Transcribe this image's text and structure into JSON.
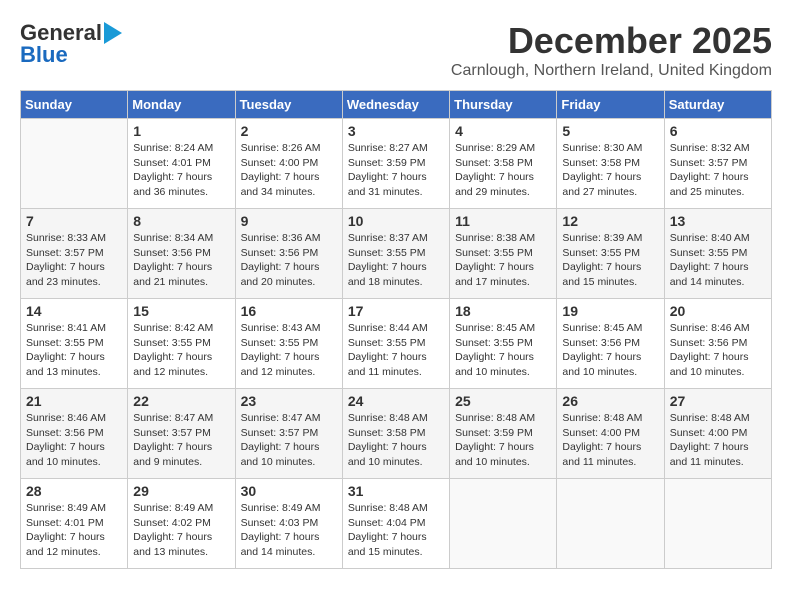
{
  "logo": {
    "line1": "General",
    "line2": "Blue"
  },
  "header": {
    "month": "December 2025",
    "location": "Carnlough, Northern Ireland, United Kingdom"
  },
  "weekdays": [
    "Sunday",
    "Monday",
    "Tuesday",
    "Wednesday",
    "Thursday",
    "Friday",
    "Saturday"
  ],
  "weeks": [
    [
      {
        "day": "",
        "sunrise": "",
        "sunset": "",
        "daylight": ""
      },
      {
        "day": "1",
        "sunrise": "Sunrise: 8:24 AM",
        "sunset": "Sunset: 4:01 PM",
        "daylight": "Daylight: 7 hours and 36 minutes."
      },
      {
        "day": "2",
        "sunrise": "Sunrise: 8:26 AM",
        "sunset": "Sunset: 4:00 PM",
        "daylight": "Daylight: 7 hours and 34 minutes."
      },
      {
        "day": "3",
        "sunrise": "Sunrise: 8:27 AM",
        "sunset": "Sunset: 3:59 PM",
        "daylight": "Daylight: 7 hours and 31 minutes."
      },
      {
        "day": "4",
        "sunrise": "Sunrise: 8:29 AM",
        "sunset": "Sunset: 3:58 PM",
        "daylight": "Daylight: 7 hours and 29 minutes."
      },
      {
        "day": "5",
        "sunrise": "Sunrise: 8:30 AM",
        "sunset": "Sunset: 3:58 PM",
        "daylight": "Daylight: 7 hours and 27 minutes."
      },
      {
        "day": "6",
        "sunrise": "Sunrise: 8:32 AM",
        "sunset": "Sunset: 3:57 PM",
        "daylight": "Daylight: 7 hours and 25 minutes."
      }
    ],
    [
      {
        "day": "7",
        "sunrise": "Sunrise: 8:33 AM",
        "sunset": "Sunset: 3:57 PM",
        "daylight": "Daylight: 7 hours and 23 minutes."
      },
      {
        "day": "8",
        "sunrise": "Sunrise: 8:34 AM",
        "sunset": "Sunset: 3:56 PM",
        "daylight": "Daylight: 7 hours and 21 minutes."
      },
      {
        "day": "9",
        "sunrise": "Sunrise: 8:36 AM",
        "sunset": "Sunset: 3:56 PM",
        "daylight": "Daylight: 7 hours and 20 minutes."
      },
      {
        "day": "10",
        "sunrise": "Sunrise: 8:37 AM",
        "sunset": "Sunset: 3:55 PM",
        "daylight": "Daylight: 7 hours and 18 minutes."
      },
      {
        "day": "11",
        "sunrise": "Sunrise: 8:38 AM",
        "sunset": "Sunset: 3:55 PM",
        "daylight": "Daylight: 7 hours and 17 minutes."
      },
      {
        "day": "12",
        "sunrise": "Sunrise: 8:39 AM",
        "sunset": "Sunset: 3:55 PM",
        "daylight": "Daylight: 7 hours and 15 minutes."
      },
      {
        "day": "13",
        "sunrise": "Sunrise: 8:40 AM",
        "sunset": "Sunset: 3:55 PM",
        "daylight": "Daylight: 7 hours and 14 minutes."
      }
    ],
    [
      {
        "day": "14",
        "sunrise": "Sunrise: 8:41 AM",
        "sunset": "Sunset: 3:55 PM",
        "daylight": "Daylight: 7 hours and 13 minutes."
      },
      {
        "day": "15",
        "sunrise": "Sunrise: 8:42 AM",
        "sunset": "Sunset: 3:55 PM",
        "daylight": "Daylight: 7 hours and 12 minutes."
      },
      {
        "day": "16",
        "sunrise": "Sunrise: 8:43 AM",
        "sunset": "Sunset: 3:55 PM",
        "daylight": "Daylight: 7 hours and 12 minutes."
      },
      {
        "day": "17",
        "sunrise": "Sunrise: 8:44 AM",
        "sunset": "Sunset: 3:55 PM",
        "daylight": "Daylight: 7 hours and 11 minutes."
      },
      {
        "day": "18",
        "sunrise": "Sunrise: 8:45 AM",
        "sunset": "Sunset: 3:55 PM",
        "daylight": "Daylight: 7 hours and 10 minutes."
      },
      {
        "day": "19",
        "sunrise": "Sunrise: 8:45 AM",
        "sunset": "Sunset: 3:56 PM",
        "daylight": "Daylight: 7 hours and 10 minutes."
      },
      {
        "day": "20",
        "sunrise": "Sunrise: 8:46 AM",
        "sunset": "Sunset: 3:56 PM",
        "daylight": "Daylight: 7 hours and 10 minutes."
      }
    ],
    [
      {
        "day": "21",
        "sunrise": "Sunrise: 8:46 AM",
        "sunset": "Sunset: 3:56 PM",
        "daylight": "Daylight: 7 hours and 10 minutes."
      },
      {
        "day": "22",
        "sunrise": "Sunrise: 8:47 AM",
        "sunset": "Sunset: 3:57 PM",
        "daylight": "Daylight: 7 hours and 9 minutes."
      },
      {
        "day": "23",
        "sunrise": "Sunrise: 8:47 AM",
        "sunset": "Sunset: 3:57 PM",
        "daylight": "Daylight: 7 hours and 10 minutes."
      },
      {
        "day": "24",
        "sunrise": "Sunrise: 8:48 AM",
        "sunset": "Sunset: 3:58 PM",
        "daylight": "Daylight: 7 hours and 10 minutes."
      },
      {
        "day": "25",
        "sunrise": "Sunrise: 8:48 AM",
        "sunset": "Sunset: 3:59 PM",
        "daylight": "Daylight: 7 hours and 10 minutes."
      },
      {
        "day": "26",
        "sunrise": "Sunrise: 8:48 AM",
        "sunset": "Sunset: 4:00 PM",
        "daylight": "Daylight: 7 hours and 11 minutes."
      },
      {
        "day": "27",
        "sunrise": "Sunrise: 8:48 AM",
        "sunset": "Sunset: 4:00 PM",
        "daylight": "Daylight: 7 hours and 11 minutes."
      }
    ],
    [
      {
        "day": "28",
        "sunrise": "Sunrise: 8:49 AM",
        "sunset": "Sunset: 4:01 PM",
        "daylight": "Daylight: 7 hours and 12 minutes."
      },
      {
        "day": "29",
        "sunrise": "Sunrise: 8:49 AM",
        "sunset": "Sunset: 4:02 PM",
        "daylight": "Daylight: 7 hours and 13 minutes."
      },
      {
        "day": "30",
        "sunrise": "Sunrise: 8:49 AM",
        "sunset": "Sunset: 4:03 PM",
        "daylight": "Daylight: 7 hours and 14 minutes."
      },
      {
        "day": "31",
        "sunrise": "Sunrise: 8:48 AM",
        "sunset": "Sunset: 4:04 PM",
        "daylight": "Daylight: 7 hours and 15 minutes."
      },
      {
        "day": "",
        "sunrise": "",
        "sunset": "",
        "daylight": ""
      },
      {
        "day": "",
        "sunrise": "",
        "sunset": "",
        "daylight": ""
      },
      {
        "day": "",
        "sunrise": "",
        "sunset": "",
        "daylight": ""
      }
    ]
  ]
}
